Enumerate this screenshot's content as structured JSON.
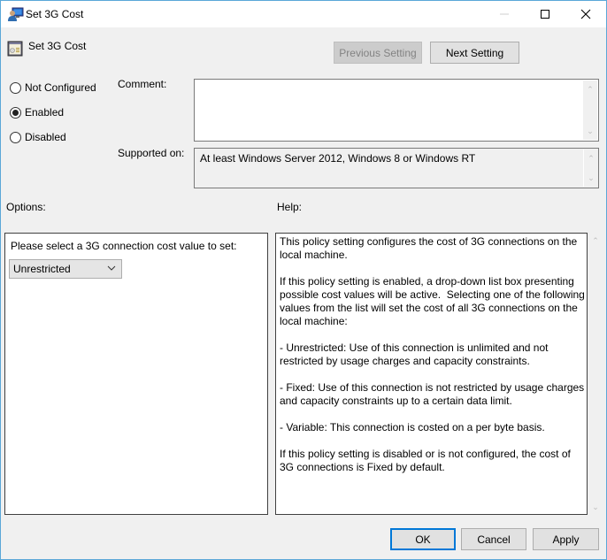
{
  "window": {
    "title": "Set 3G Cost",
    "controls": {
      "minimize": "minimize",
      "maximize": "maximize",
      "close": "close"
    }
  },
  "header": {
    "title": "Set 3G Cost",
    "previous_label": "Previous Setting",
    "previous_disabled": true,
    "next_label": "Next Setting"
  },
  "state": {
    "options": [
      {
        "label": "Not Configured",
        "checked": false
      },
      {
        "label": "Enabled",
        "checked": true
      },
      {
        "label": "Disabled",
        "checked": false
      }
    ]
  },
  "comment": {
    "label": "Comment:",
    "value": ""
  },
  "supported": {
    "label": "Supported on:",
    "value": "At least Windows Server 2012, Windows 8 or Windows RT"
  },
  "options_section": {
    "label": "Options:",
    "prompt": "Please select a 3G connection cost value to set:",
    "dropdown_value": "Unrestricted"
  },
  "help_section": {
    "label": "Help:",
    "text": "This policy setting configures the cost of 3G connections on the local machine.\n\nIf this policy setting is enabled, a drop-down list box presenting possible cost values will be active.  Selecting one of the following values from the list will set the cost of all 3G connections on the local machine:\n\n- Unrestricted: Use of this connection is unlimited and not restricted by usage charges and capacity constraints.\n\n- Fixed: Use of this connection is not restricted by usage charges and capacity constraints up to a certain data limit.\n\n- Variable: This connection is costed on a per byte basis.\n\nIf this policy setting is disabled or is not configured, the cost of 3G connections is Fixed by default."
  },
  "footer": {
    "ok_label": "OK",
    "cancel_label": "Cancel",
    "apply_label": "Apply"
  },
  "colors": {
    "window_border": "#5aa7d8",
    "default_button_border": "#0078d7",
    "dialog_bg": "#f0f0f0"
  }
}
